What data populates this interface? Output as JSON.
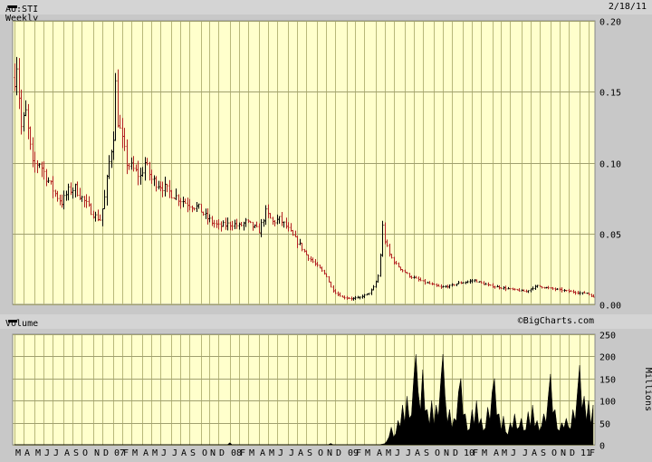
{
  "header": {
    "symbol": "AU:STI Weekly",
    "date": "2/18/11"
  },
  "volume_header": {
    "label": "Volume",
    "brand": "©BigCharts.com"
  },
  "colors": {
    "panel_bg": "#ffffcc",
    "grid": "#b8b87a",
    "up": "#000000",
    "down": "#b22222",
    "volume": "#000000"
  },
  "chart_data": [
    {
      "type": "bar",
      "subtype": "ohlc",
      "title": "AU:STI Weekly",
      "date": "2/18/11",
      "ylim": [
        0,
        0.2
      ],
      "yticks": [
        "0.20",
        "0.15",
        "0.10",
        "0.05",
        "0.00"
      ],
      "grid": true,
      "x_labels": [
        {
          "label": "M",
          "i": 0
        },
        {
          "label": "A",
          "i": 4
        },
        {
          "label": "M",
          "i": 9
        },
        {
          "label": "J",
          "i": 13
        },
        {
          "label": "J",
          "i": 17
        },
        {
          "label": "A",
          "i": 22
        },
        {
          "label": "S",
          "i": 26
        },
        {
          "label": "O",
          "i": 30
        },
        {
          "label": "N",
          "i": 35
        },
        {
          "label": "D",
          "i": 39
        },
        {
          "label": "07",
          "i": 44
        },
        {
          "label": "F",
          "i": 48
        },
        {
          "label": "M",
          "i": 52
        },
        {
          "label": "A",
          "i": 57
        },
        {
          "label": "M",
          "i": 61
        },
        {
          "label": "J",
          "i": 65
        },
        {
          "label": "J",
          "i": 70
        },
        {
          "label": "A",
          "i": 74
        },
        {
          "label": "S",
          "i": 78
        },
        {
          "label": "O",
          "i": 83
        },
        {
          "label": "N",
          "i": 87
        },
        {
          "label": "D",
          "i": 91
        },
        {
          "label": "08",
          "i": 96
        },
        {
          "label": "F",
          "i": 100
        },
        {
          "label": "M",
          "i": 104
        },
        {
          "label": "A",
          "i": 109
        },
        {
          "label": "M",
          "i": 113
        },
        {
          "label": "J",
          "i": 117
        },
        {
          "label": "J",
          "i": 122
        },
        {
          "label": "A",
          "i": 126
        },
        {
          "label": "S",
          "i": 130
        },
        {
          "label": "O",
          "i": 135
        },
        {
          "label": "N",
          "i": 139
        },
        {
          "label": "D",
          "i": 143
        },
        {
          "label": "09",
          "i": 148
        },
        {
          "label": "F",
          "i": 152
        },
        {
          "label": "M",
          "i": 156
        },
        {
          "label": "A",
          "i": 161
        },
        {
          "label": "M",
          "i": 165
        },
        {
          "label": "J",
          "i": 169
        },
        {
          "label": "J",
          "i": 174
        },
        {
          "label": "A",
          "i": 178
        },
        {
          "label": "S",
          "i": 182
        },
        {
          "label": "O",
          "i": 187
        },
        {
          "label": "N",
          "i": 191
        },
        {
          "label": "D",
          "i": 195
        },
        {
          "label": "10",
          "i": 200
        },
        {
          "label": "F",
          "i": 204
        },
        {
          "label": "M",
          "i": 208
        },
        {
          "label": "A",
          "i": 213
        },
        {
          "label": "M",
          "i": 217
        },
        {
          "label": "J",
          "i": 221
        },
        {
          "label": "J",
          "i": 226
        },
        {
          "label": "A",
          "i": 230
        },
        {
          "label": "S",
          "i": 234
        },
        {
          "label": "O",
          "i": 239
        },
        {
          "label": "N",
          "i": 243
        },
        {
          "label": "D",
          "i": 247
        },
        {
          "label": "11",
          "i": 252
        },
        {
          "label": "F",
          "i": 256
        }
      ],
      "anchors": [
        [
          0,
          0.16
        ],
        [
          1,
          0.17
        ],
        [
          3,
          0.125
        ],
        [
          5,
          0.135
        ],
        [
          8,
          0.098
        ],
        [
          11,
          0.1
        ],
        [
          14,
          0.09
        ],
        [
          18,
          0.078
        ],
        [
          21,
          0.072
        ],
        [
          24,
          0.08
        ],
        [
          27,
          0.082
        ],
        [
          30,
          0.075
        ],
        [
          33,
          0.068
        ],
        [
          36,
          0.062
        ],
        [
          38,
          0.06
        ],
        [
          40,
          0.075
        ],
        [
          42,
          0.1
        ],
        [
          44,
          0.12
        ],
        [
          45,
          0.155
        ],
        [
          46,
          0.13
        ],
        [
          48,
          0.115
        ],
        [
          50,
          0.1
        ],
        [
          53,
          0.095
        ],
        [
          56,
          0.09
        ],
        [
          58,
          0.1
        ],
        [
          61,
          0.088
        ],
        [
          64,
          0.085
        ],
        [
          67,
          0.082
        ],
        [
          70,
          0.078
        ],
        [
          73,
          0.075
        ],
        [
          76,
          0.072
        ],
        [
          79,
          0.07
        ],
        [
          82,
          0.068
        ],
        [
          85,
          0.062
        ],
        [
          88,
          0.058
        ],
        [
          91,
          0.055
        ],
        [
          94,
          0.056
        ],
        [
          97,
          0.057
        ],
        [
          100,
          0.055
        ],
        [
          103,
          0.058
        ],
        [
          106,
          0.055
        ],
        [
          109,
          0.052
        ],
        [
          112,
          0.065
        ],
        [
          115,
          0.058
        ],
        [
          118,
          0.06
        ],
        [
          121,
          0.055
        ],
        [
          124,
          0.048
        ],
        [
          127,
          0.042
        ],
        [
          130,
          0.035
        ],
        [
          133,
          0.03
        ],
        [
          136,
          0.025
        ],
        [
          139,
          0.02
        ],
        [
          141,
          0.012
        ],
        [
          143,
          0.008
        ],
        [
          146,
          0.005
        ],
        [
          150,
          0.004
        ],
        [
          154,
          0.005
        ],
        [
          158,
          0.008
        ],
        [
          160,
          0.012
        ],
        [
          162,
          0.02
        ],
        [
          163,
          0.035
        ],
        [
          164,
          0.055
        ],
        [
          165,
          0.045
        ],
        [
          167,
          0.035
        ],
        [
          170,
          0.028
        ],
        [
          173,
          0.024
        ],
        [
          176,
          0.02
        ],
        [
          179,
          0.018
        ],
        [
          182,
          0.016
        ],
        [
          186,
          0.014
        ],
        [
          190,
          0.012
        ],
        [
          194,
          0.013
        ],
        [
          198,
          0.015
        ],
        [
          202,
          0.016
        ],
        [
          205,
          0.017
        ],
        [
          208,
          0.015
        ],
        [
          212,
          0.013
        ],
        [
          216,
          0.012
        ],
        [
          220,
          0.011
        ],
        [
          224,
          0.01
        ],
        [
          228,
          0.009
        ],
        [
          230,
          0.011
        ],
        [
          233,
          0.013
        ],
        [
          236,
          0.012
        ],
        [
          240,
          0.011
        ],
        [
          244,
          0.01
        ],
        [
          248,
          0.009
        ],
        [
          252,
          0.008
        ],
        [
          255,
          0.008
        ],
        [
          258,
          0.005
        ]
      ]
    },
    {
      "type": "area",
      "title": "Volume",
      "ylabel": "Millions",
      "ylim": [
        0,
        250
      ],
      "yticks": [
        "250",
        "200",
        "150",
        "100",
        "50",
        "0"
      ],
      "baseline_values": [
        [
          0,
          0.5
        ],
        [
          95,
          0.5
        ],
        [
          96,
          5
        ],
        [
          97,
          0.5
        ],
        [
          140,
          0.5
        ],
        [
          141,
          3
        ],
        [
          142,
          0.5
        ],
        [
          163,
          0.5
        ],
        [
          166,
          3
        ],
        [
          170,
          8
        ],
        [
          175,
          20
        ],
        [
          180,
          35
        ],
        [
          185,
          40
        ],
        [
          190,
          38
        ],
        [
          195,
          35
        ],
        [
          200,
          30
        ],
        [
          205,
          32
        ],
        [
          210,
          28
        ],
        [
          215,
          30
        ],
        [
          220,
          28
        ],
        [
          225,
          32
        ],
        [
          230,
          30
        ],
        [
          235,
          35
        ],
        [
          240,
          30
        ],
        [
          245,
          38
        ],
        [
          250,
          40
        ],
        [
          255,
          45
        ],
        [
          258,
          48
        ]
      ],
      "spikes": [
        [
          168,
          40
        ],
        [
          171,
          55
        ],
        [
          173,
          90
        ],
        [
          175,
          110
        ],
        [
          176,
          60
        ],
        [
          178,
          150
        ],
        [
          179,
          205
        ],
        [
          180,
          120
        ],
        [
          182,
          170
        ],
        [
          184,
          80
        ],
        [
          186,
          100
        ],
        [
          188,
          90
        ],
        [
          190,
          140
        ],
        [
          191,
          205
        ],
        [
          192,
          110
        ],
        [
          194,
          80
        ],
        [
          196,
          60
        ],
        [
          198,
          120
        ],
        [
          199,
          150
        ],
        [
          201,
          70
        ],
        [
          204,
          80
        ],
        [
          206,
          100
        ],
        [
          208,
          60
        ],
        [
          211,
          85
        ],
        [
          213,
          120
        ],
        [
          214,
          150
        ],
        [
          216,
          70
        ],
        [
          218,
          65
        ],
        [
          221,
          50
        ],
        [
          223,
          70
        ],
        [
          226,
          60
        ],
        [
          229,
          75
        ],
        [
          231,
          90
        ],
        [
          233,
          55
        ],
        [
          236,
          70
        ],
        [
          238,
          110
        ],
        [
          239,
          160
        ],
        [
          241,
          80
        ],
        [
          244,
          50
        ],
        [
          246,
          60
        ],
        [
          249,
          80
        ],
        [
          251,
          120
        ],
        [
          252,
          180
        ],
        [
          254,
          110
        ],
        [
          256,
          100
        ],
        [
          258,
          90
        ]
      ]
    }
  ]
}
